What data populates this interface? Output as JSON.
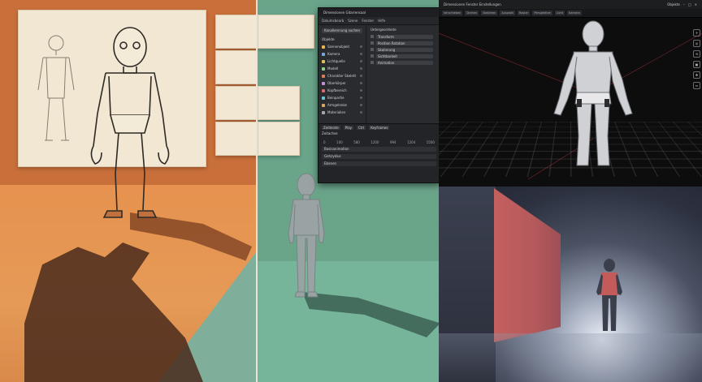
{
  "editor": {
    "title": "Dimensionen  Gitarrensaal",
    "menu": [
      "Datumsbearb",
      "Szene",
      "Fenster",
      "Hilfe"
    ],
    "search_placeholder": "Kanalkennung suchen",
    "left_tab": "Objekte",
    "right_title": "Untergeordnete",
    "tree_items": [
      {
        "label": "Szenenobjekt",
        "color": "#e8b84a"
      },
      {
        "label": "Kamera",
        "color": "#7aa7d9"
      },
      {
        "label": "Lichtquelle",
        "color": "#e0c05a"
      },
      {
        "label": "Modell",
        "color": "#8fcf8a"
      },
      {
        "label": "Charakter Skelett",
        "color": "#d97f5a"
      },
      {
        "label": "Oberkörper",
        "color": "#c48fd9"
      },
      {
        "label": "Kopfbereich",
        "color": "#d96a6a"
      },
      {
        "label": "Beinpartie",
        "color": "#6ac3d9"
      },
      {
        "label": "Armgelenke",
        "color": "#d9a66a"
      },
      {
        "label": "Materialien",
        "color": "#a4a9b0"
      }
    ],
    "properties": [
      "Transform",
      "Position Rotation",
      "Skalierung",
      "Sichtbarkeit",
      "Animation"
    ],
    "timeline_tabs": [
      "Zeitleiste",
      "Play",
      "Ctrl",
      "Keyframes"
    ],
    "timeline_label": "Zeitachse",
    "timeline_numbers": [
      "0",
      "100",
      "580",
      "1200",
      "994",
      "1204",
      "1500"
    ],
    "timeline_rows": [
      "Basisanimation",
      "Gehzyklus",
      "Ebenen"
    ]
  },
  "viewport": {
    "title": "Dimensionen  Fenster  Einstellungen",
    "right_label": "Objekte",
    "tools": [
      "Verschieben",
      "Drehen",
      "Skalieren",
      "Auswahl",
      "Raster",
      "Perspektive",
      "Licht",
      "Kamera"
    ],
    "side_icons": [
      "+",
      "◎",
      "⟲",
      "▣",
      "✥",
      "⇔"
    ]
  }
}
